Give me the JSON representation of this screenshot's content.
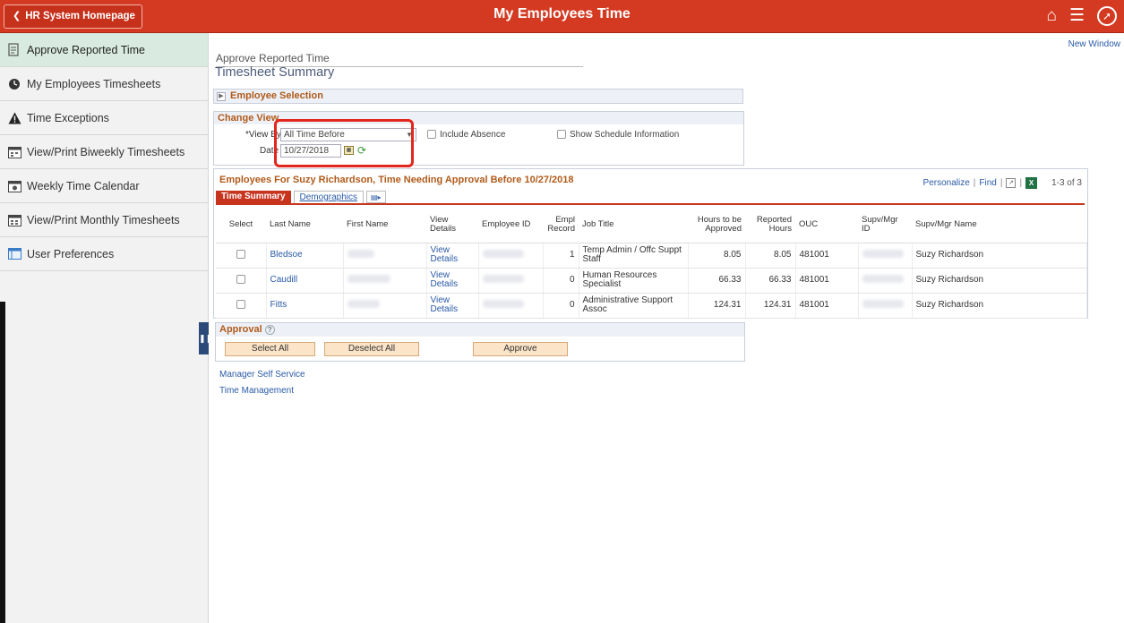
{
  "header": {
    "back_label": "HR System Homepage",
    "title": "My Employees Time",
    "new_window": "New Window"
  },
  "sidebar": {
    "items": [
      {
        "label": "Approve Reported Time",
        "icon": "document-pencil-icon"
      },
      {
        "label": "My Employees Timesheets",
        "icon": "clock-icon"
      },
      {
        "label": "Time Exceptions",
        "icon": "warning-icon"
      },
      {
        "label": "View/Print Biweekly Timesheets",
        "icon": "calendar-icon"
      },
      {
        "label": "Weekly Time Calendar",
        "icon": "calendar-icon"
      },
      {
        "label": "View/Print Monthly Timesheets",
        "icon": "calendar-icon"
      },
      {
        "label": "User Preferences",
        "icon": "window-icon"
      }
    ]
  },
  "main": {
    "breadcrumb": "Approve Reported Time",
    "title": "Timesheet Summary",
    "employee_selection": "Employee Selection",
    "change_view": {
      "header": "Change View",
      "view_by_label": "*View By",
      "view_by_value": "All Time Before",
      "date_label": "Date",
      "date_value": "10/27/2018",
      "include_absence": "Include Absence",
      "show_schedule": "Show Schedule Information"
    },
    "grid": {
      "title": "Employees For Suzy Richardson, Time Needing Approval Before 10/27/2018",
      "personalize": "Personalize",
      "find": "Find",
      "count": "1-3 of 3",
      "tabs": [
        "Time Summary",
        "Demographics"
      ],
      "columns": {
        "select": "Select",
        "last_name": "Last Name",
        "first_name": "First Name",
        "view_details": "View Details",
        "employee_id": "Employee ID",
        "empl_record": "Empl Record",
        "job_title": "Job Title",
        "hours_to_be_approved": "Hours to be Approved",
        "reported_hours": "Reported Hours",
        "ouc": "OUC",
        "supv_mgr_id": "Supv/Mgr ID",
        "supv_mgr_name": "Supv/Mgr Name"
      },
      "rows": [
        {
          "last_name": "Bledsoe",
          "view_details": "View Details",
          "empl_record": "1",
          "job_title": "Temp Admin / Offc Suppt Staff",
          "hours_to_be_approved": "8.05",
          "reported_hours": "8.05",
          "ouc": "481001",
          "supv_mgr_name": "Suzy Richardson"
        },
        {
          "last_name": "Caudill",
          "view_details": "View Details",
          "empl_record": "0",
          "job_title": "Human Resources Specialist",
          "hours_to_be_approved": "66.33",
          "reported_hours": "66.33",
          "ouc": "481001",
          "supv_mgr_name": "Suzy Richardson"
        },
        {
          "last_name": "Fitts",
          "view_details": "View Details",
          "empl_record": "0",
          "job_title": "Administrative Support Assoc",
          "hours_to_be_approved": "124.31",
          "reported_hours": "124.31",
          "ouc": "481001",
          "supv_mgr_name": "Suzy Richardson"
        }
      ]
    },
    "approval": {
      "header": "Approval",
      "select_all": "Select All",
      "deselect_all": "Deselect All",
      "approve": "Approve"
    },
    "footer_links": [
      "Manager Self Service",
      "Time Management"
    ]
  },
  "colors": {
    "banner": "#d43a21",
    "section_header_text": "#b05a1a",
    "link": "#2a5aa6",
    "active_nav": "#d9ebe0",
    "highlight_annotation": "#e2271d"
  }
}
